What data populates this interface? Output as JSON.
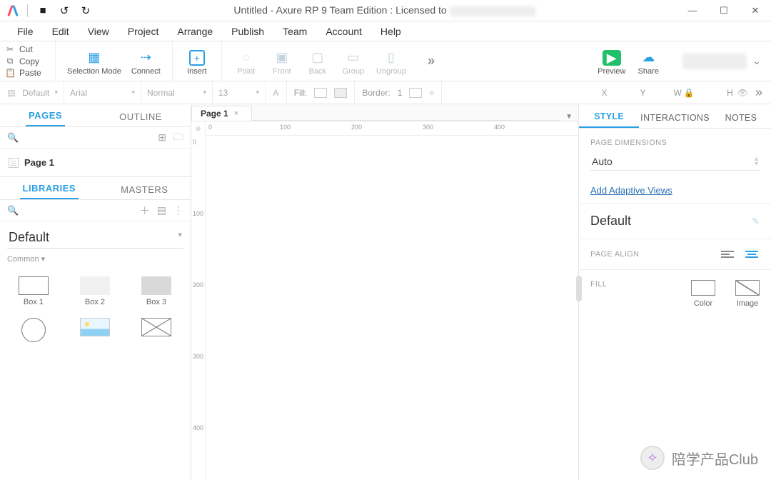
{
  "title": {
    "app": "Untitled - Axure RP 9 Team Edition : Licensed to "
  },
  "menubar": [
    "File",
    "Edit",
    "View",
    "Project",
    "Arrange",
    "Publish",
    "Team",
    "Account",
    "Help"
  ],
  "clipboard": {
    "cut": "Cut",
    "copy": "Copy",
    "paste": "Paste"
  },
  "toolbar": {
    "selection_mode": "Selection Mode",
    "connect": "Connect",
    "insert": "Insert",
    "point": "Point",
    "front": "Front",
    "back": "Back",
    "group": "Group",
    "ungroup": "Ungroup",
    "preview": "Preview",
    "share": "Share"
  },
  "stylebar": {
    "style_preset": "Default",
    "font": "Arial",
    "weight": "Normal",
    "size": "13",
    "fill_label": "Fill:",
    "border_label": "Border:",
    "border_width": "1",
    "x_label": "X",
    "y_label": "Y",
    "w_label": "W",
    "h_label": "H"
  },
  "left": {
    "tabs": {
      "pages": "PAGES",
      "outline": "OUTLINE"
    },
    "page1": "Page 1",
    "lib_tabs": {
      "libraries": "LIBRARIES",
      "masters": "MASTERS"
    },
    "lib_selected": "Default",
    "lib_category": "Common ▾",
    "widgets": {
      "box1": "Box 1",
      "box2": "Box 2",
      "box3": "Box 3"
    }
  },
  "canvas": {
    "tab": "Page 1",
    "ruler_h": [
      "0",
      "100",
      "200",
      "300",
      "400"
    ],
    "ruler_v": [
      "0",
      "100",
      "200",
      "300",
      "400"
    ]
  },
  "right": {
    "tabs": {
      "style": "STYLE",
      "interactions": "INTERACTIONS",
      "notes": "NOTES"
    },
    "page_dimensions_label": "PAGE DIMENSIONS",
    "page_dimensions_value": "Auto",
    "add_adaptive": "Add Adaptive Views",
    "default_style": "Default",
    "page_align_label": "PAGE ALIGN",
    "fill_label": "FILL",
    "fill_color": "Color",
    "fill_image": "Image"
  },
  "watermark": "陪学产品Club"
}
